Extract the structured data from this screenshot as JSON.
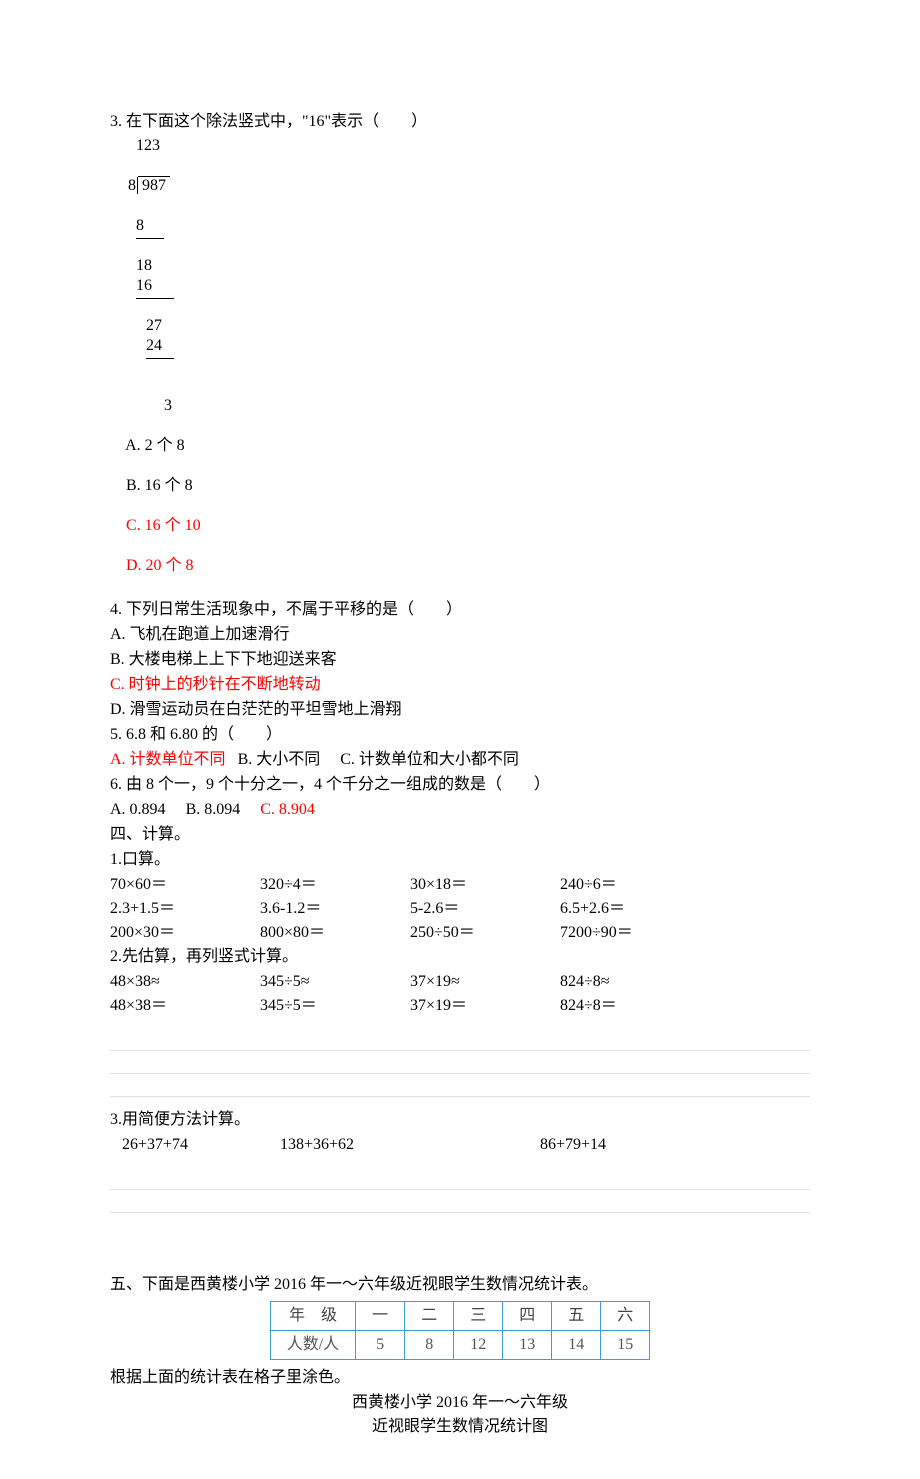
{
  "q3": {
    "prompt": "3. 在下面这个除法竖式中，\"16\"表示（　　）",
    "division": {
      "quotient": "123",
      "divisor": "8",
      "dividend": "987",
      "step1_sub": "8",
      "step2_bring": "18",
      "step2_sub": "16",
      "step3_bring": "27",
      "step3_sub": "24",
      "remainder": "3"
    },
    "optA": "A. 2 个 8",
    "optB": "B. 16 个 8",
    "optC": "C. 16 个 10",
    "optD": "D. 20 个 8"
  },
  "q4": {
    "prompt": "4. 下列日常生活现象中，不属于平移的是（　　）",
    "A": "A. 飞机在跑道上加速滑行",
    "B": "B. 大楼电梯上上下下地迎送来客",
    "C": "C. 时钟上的秒针在不断地转动",
    "D": "D. 滑雪运动员在白茫茫的平坦雪地上滑翔"
  },
  "q5": {
    "prompt": "5. 6.8 和 6.80 的（　　）",
    "A": "A. 计数单位不同",
    "B": "B. 大小不同",
    "C": "C. 计数单位和大小都不同"
  },
  "q6": {
    "prompt": "6. 由 8 个一，9 个十分之一，4 个千分之一组成的数是（　　）",
    "A": "A. 0.894",
    "B": "B. 8.094",
    "C": "C. 8.904"
  },
  "s4": {
    "title": "四、计算。",
    "p1": "1.口算。",
    "r1": [
      "70×60＝",
      "320÷4＝",
      "30×18＝",
      "240÷6＝"
    ],
    "r2": [
      "2.3+1.5＝",
      "3.6-1.2＝",
      "5-2.6＝",
      "6.5+2.6＝"
    ],
    "r3": [
      "200×30＝",
      "800×80＝",
      "250÷50＝",
      "7200÷90＝"
    ],
    "p2": "2.先估算，再列竖式计算。",
    "e1": [
      "48×38≈",
      "345÷5≈",
      "37×19≈",
      "824÷8≈"
    ],
    "e2": [
      "48×38＝",
      "345÷5＝",
      "37×19＝",
      "824÷8＝"
    ],
    "p3": "3.用简便方法计算。",
    "m1": [
      "26+37+74",
      "138+36+62",
      "86+79+14"
    ]
  },
  "s5": {
    "title": "五、下面是西黄楼小学 2016 年一～六年级近视眼学生数情况统计表。",
    "headers": [
      "年　级",
      "一",
      "二",
      "三",
      "四",
      "五",
      "六"
    ],
    "rowlabel": "人数/人",
    "values": [
      "5",
      "8",
      "12",
      "13",
      "14",
      "15"
    ],
    "after": "根据上面的统计表在格子里涂色。",
    "chart_title1": "西黄楼小学 2016 年一～六年级",
    "chart_title2": "近视眼学生数情况统计图"
  },
  "chart_data": {
    "type": "table",
    "title": "西黄楼小学 2016 年一～六年级近视眼学生数情况统计表",
    "categories": [
      "一",
      "二",
      "三",
      "四",
      "五",
      "六"
    ],
    "values": [
      5,
      8,
      12,
      13,
      14,
      15
    ],
    "xlabel": "年级",
    "ylabel": "人数/人"
  }
}
